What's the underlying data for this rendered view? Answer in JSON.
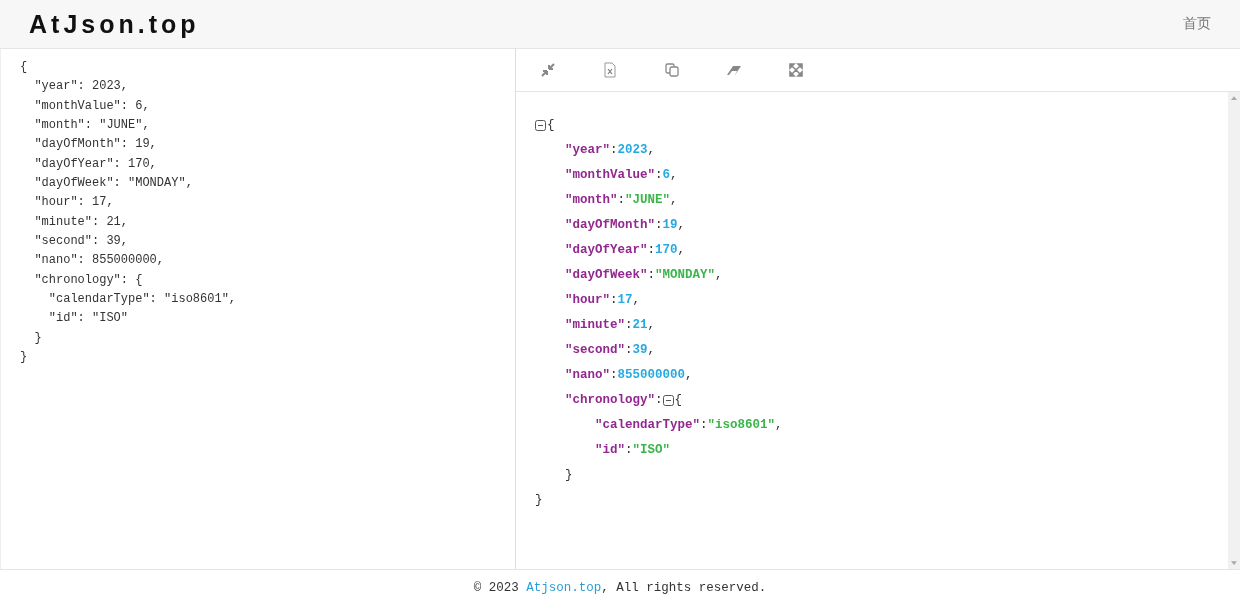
{
  "header": {
    "logo": "AtJson.top",
    "nav": [
      {
        "label": "首页"
      }
    ]
  },
  "editor": {
    "lines": [
      "{",
      "  \"year\": 2023,",
      "  \"monthValue\": 6,",
      "  \"month\": \"JUNE\",",
      "  \"dayOfMonth\": 19,",
      "  \"dayOfYear\": 170,",
      "  \"dayOfWeek\": \"MONDAY\",",
      "  \"hour\": 17,",
      "  \"minute\": 21,",
      "  \"second\": 39,",
      "  \"nano\": 855000000,",
      "  \"chronology\": {",
      "    \"calendarType\": \"iso8601\",",
      "    \"id\": \"ISO\"",
      "  }",
      "}"
    ]
  },
  "viewer": {
    "root": {
      "expanded": true,
      "open": "{",
      "close": "}",
      "children": [
        {
          "kind": "number",
          "key": "\"year\"",
          "sep": ":",
          "value": "2023",
          "comma": ","
        },
        {
          "kind": "number",
          "key": "\"monthValue\"",
          "sep": ":",
          "value": "6",
          "comma": ","
        },
        {
          "kind": "string",
          "key": "\"month\"",
          "sep": ":",
          "value": "\"JUNE\"",
          "comma": ","
        },
        {
          "kind": "number",
          "key": "\"dayOfMonth\"",
          "sep": ":",
          "value": "19",
          "comma": ","
        },
        {
          "kind": "number",
          "key": "\"dayOfYear\"",
          "sep": ":",
          "value": "170",
          "comma": ","
        },
        {
          "kind": "string",
          "key": "\"dayOfWeek\"",
          "sep": ":",
          "value": "\"MONDAY\"",
          "comma": ","
        },
        {
          "kind": "number",
          "key": "\"hour\"",
          "sep": ":",
          "value": "17",
          "comma": ","
        },
        {
          "kind": "number",
          "key": "\"minute\"",
          "sep": ":",
          "value": "21",
          "comma": ","
        },
        {
          "kind": "number",
          "key": "\"second\"",
          "sep": ":",
          "value": "39",
          "comma": ","
        },
        {
          "kind": "number",
          "key": "\"nano\"",
          "sep": ":",
          "value": "855000000",
          "comma": ","
        },
        {
          "kind": "object",
          "key": "\"chronology\"",
          "sep": ":",
          "expanded": true,
          "open": "{",
          "close": "}",
          "children": [
            {
              "kind": "string",
              "key": "\"calendarType\"",
              "sep": ":",
              "value": "\"iso8601\"",
              "comma": ","
            },
            {
              "kind": "string",
              "key": "\"id\"",
              "sep": ":",
              "value": "\"ISO\""
            }
          ]
        }
      ]
    }
  },
  "footer": {
    "before": "© 2023 ",
    "link": "Atjson.top",
    "after": ", All rights reserved."
  }
}
